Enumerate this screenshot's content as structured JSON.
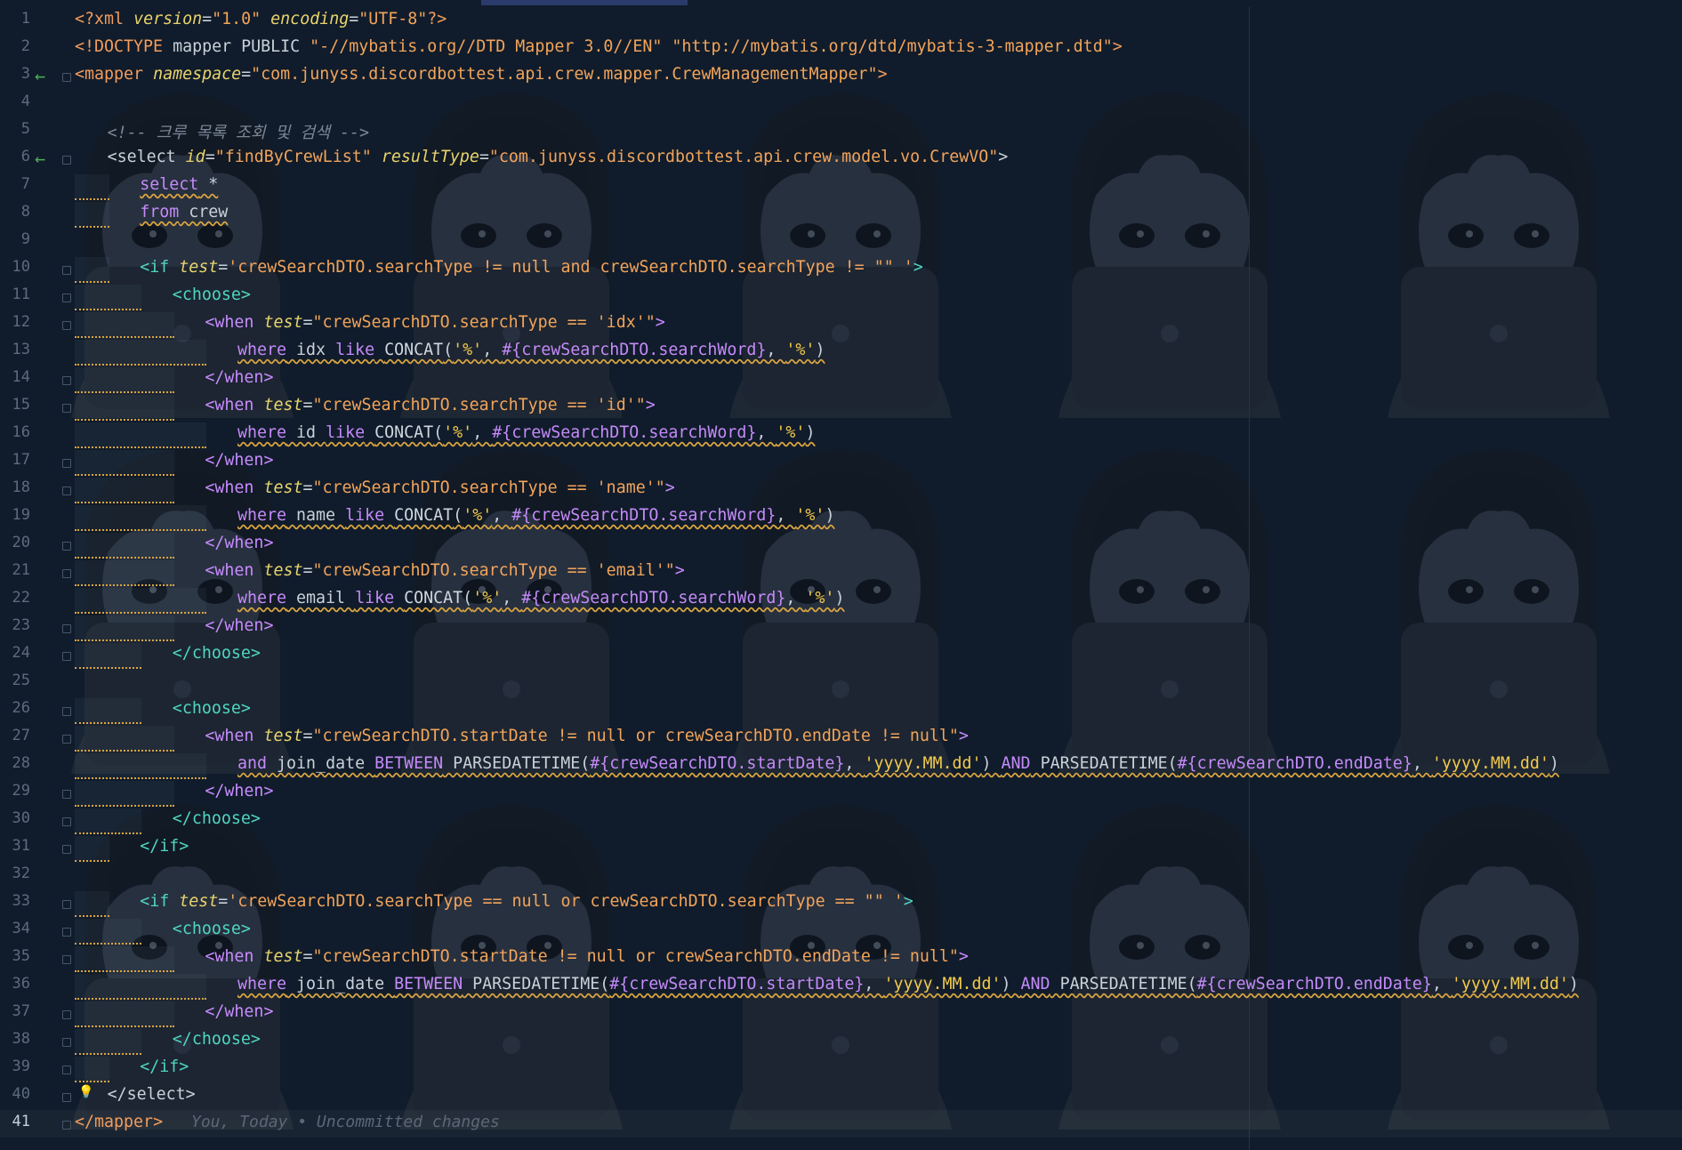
{
  "editor": {
    "blame_text": "You, Today • Uncommitted changes",
    "current_line": 41,
    "lines": [
      {
        "n": 1,
        "indent": 0,
        "code": "<?xml version=\"1.0\" encoding=\"UTF-8\"?>"
      },
      {
        "n": 2,
        "indent": 0,
        "code": "<!DOCTYPE mapper PUBLIC \"-//mybatis.org//DTD Mapper 3.0//EN\" \"http://mybatis.org/dtd/mybatis-3-mapper.dtd\">"
      },
      {
        "n": 3,
        "indent": 0,
        "code": "<mapper namespace=\"com.junyss.discordbottest.api.crew.mapper.CrewManagementMapper\">",
        "arrow": true,
        "fold": true
      },
      {
        "n": 4,
        "indent": 0,
        "code": ""
      },
      {
        "n": 5,
        "indent": 1,
        "code": "<!-- 크루 목록 조회 및 검색 -->"
      },
      {
        "n": 6,
        "indent": 1,
        "code": "<select id=\"findByCrewList\" resultType=\"com.junyss.discordbottest.api.crew.model.vo.CrewVO\">",
        "arrow": true,
        "fold": true
      },
      {
        "n": 7,
        "indent": 2,
        "code": "select *"
      },
      {
        "n": 8,
        "indent": 2,
        "code": "from crew"
      },
      {
        "n": 9,
        "indent": 0,
        "code": ""
      },
      {
        "n": 10,
        "indent": 2,
        "code": "<if test='crewSearchDTO.searchType != null and crewSearchDTO.searchType != \"\" '>",
        "fold": true
      },
      {
        "n": 11,
        "indent": 3,
        "code": "<choose>",
        "fold": true
      },
      {
        "n": 12,
        "indent": 4,
        "code": "<when test=\"crewSearchDTO.searchType == 'idx'\">",
        "fold": true
      },
      {
        "n": 13,
        "indent": 5,
        "code": "where idx like CONCAT('%', #{crewSearchDTO.searchWord}, '%')"
      },
      {
        "n": 14,
        "indent": 4,
        "code": "</when>",
        "fold": true
      },
      {
        "n": 15,
        "indent": 4,
        "code": "<when test=\"crewSearchDTO.searchType == 'id'\">",
        "fold": true
      },
      {
        "n": 16,
        "indent": 5,
        "code": "where id like CONCAT('%', #{crewSearchDTO.searchWord}, '%')"
      },
      {
        "n": 17,
        "indent": 4,
        "code": "</when>",
        "fold": true
      },
      {
        "n": 18,
        "indent": 4,
        "code": "<when test=\"crewSearchDTO.searchType == 'name'\">",
        "fold": true
      },
      {
        "n": 19,
        "indent": 5,
        "code": "where name like CONCAT('%', #{crewSearchDTO.searchWord}, '%')"
      },
      {
        "n": 20,
        "indent": 4,
        "code": "</when>",
        "fold": true
      },
      {
        "n": 21,
        "indent": 4,
        "code": "<when test=\"crewSearchDTO.searchType == 'email'\">",
        "fold": true
      },
      {
        "n": 22,
        "indent": 5,
        "code": "where email like CONCAT('%', #{crewSearchDTO.searchWord}, '%')"
      },
      {
        "n": 23,
        "indent": 4,
        "code": "</when>",
        "fold": true
      },
      {
        "n": 24,
        "indent": 3,
        "code": "</choose>",
        "fold": true
      },
      {
        "n": 25,
        "indent": 0,
        "code": ""
      },
      {
        "n": 26,
        "indent": 3,
        "code": "<choose>",
        "fold": true
      },
      {
        "n": 27,
        "indent": 4,
        "code": "<when test=\"crewSearchDTO.startDate != null or crewSearchDTO.endDate != null\">",
        "fold": true
      },
      {
        "n": 28,
        "indent": 5,
        "code": "and join_date BETWEEN PARSEDATETIME(#{crewSearchDTO.startDate}, 'yyyy.MM.dd') AND PARSEDATETIME(#{crewSearchDTO.endDate}, 'yyyy.MM.dd')"
      },
      {
        "n": 29,
        "indent": 4,
        "code": "</when>",
        "fold": true
      },
      {
        "n": 30,
        "indent": 3,
        "code": "</choose>",
        "fold": true
      },
      {
        "n": 31,
        "indent": 2,
        "code": "</if>",
        "fold": true
      },
      {
        "n": 32,
        "indent": 0,
        "code": ""
      },
      {
        "n": 33,
        "indent": 2,
        "code": "<if test='crewSearchDTO.searchType == null or crewSearchDTO.searchType == \"\" '>",
        "fold": true
      },
      {
        "n": 34,
        "indent": 3,
        "code": "<choose>",
        "fold": true
      },
      {
        "n": 35,
        "indent": 4,
        "code": "<when test=\"crewSearchDTO.startDate != null or crewSearchDTO.endDate != null\">",
        "fold": true
      },
      {
        "n": 36,
        "indent": 5,
        "code": "where join_date BETWEEN PARSEDATETIME(#{crewSearchDTO.startDate}, 'yyyy.MM.dd') AND PARSEDATETIME(#{crewSearchDTO.endDate}, 'yyyy.MM.dd')"
      },
      {
        "n": 37,
        "indent": 4,
        "code": "</when>",
        "fold": true
      },
      {
        "n": 38,
        "indent": 3,
        "code": "</choose>",
        "fold": true
      },
      {
        "n": 39,
        "indent": 2,
        "code": "</if>",
        "fold": true
      },
      {
        "n": 40,
        "indent": 1,
        "code": "</select>",
        "fold": true,
        "bulb": true
      },
      {
        "n": 41,
        "indent": 0,
        "code": "</mapper>",
        "fold": true
      }
    ]
  },
  "colors": {
    "background": "#101c2b",
    "tag": "#f39c5c",
    "attribute": "#e8d36b",
    "string": "#f2a45a",
    "keyword": "#c58af9",
    "comment": "#7c8796",
    "gutter_arrow": "#4fae5a"
  },
  "icons": {
    "gutter_arrow": "←",
    "bulb": "💡"
  }
}
